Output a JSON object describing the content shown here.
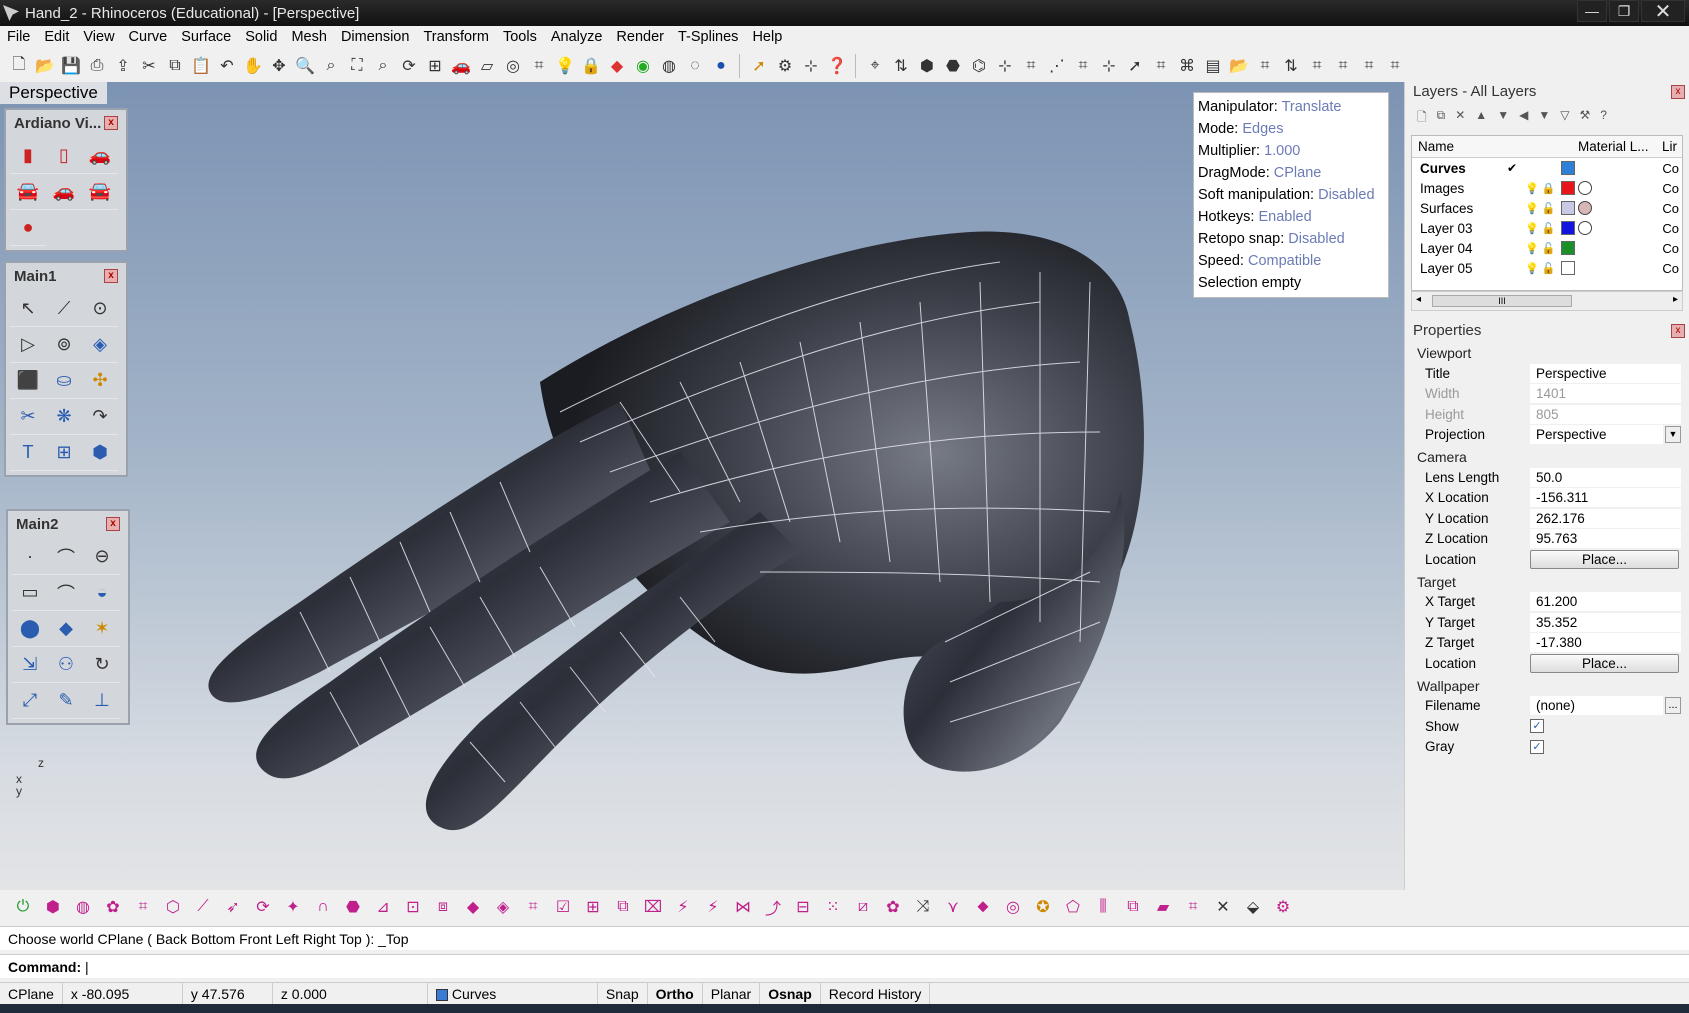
{
  "window": {
    "title": "Hand_2 - Rhinoceros (Educational) - [Perspective]",
    "minimize": "—",
    "maximize": "❐",
    "close": "✕"
  },
  "menu": [
    "File",
    "Edit",
    "View",
    "Curve",
    "Surface",
    "Solid",
    "Mesh",
    "Dimension",
    "Transform",
    "Tools",
    "Analyze",
    "Render",
    "T-Splines",
    "Help"
  ],
  "toolbar_icons": [
    "new-file-icon",
    "open-file-icon",
    "save-icon",
    "print-icon",
    "import-icon",
    "cut-icon",
    "copy-icon",
    "paste-icon",
    "undo-icon",
    "pan-hand-icon",
    "rotate-view-icon",
    "zoom-icon",
    "zoom-window-icon",
    "zoom-extents-icon",
    "zoom-selected-icon",
    "rotate-icon",
    "four-viewports-icon",
    "car-icon",
    "cplane-icon",
    "osnap-icon",
    "grid-icon",
    "light-icon",
    "lock-icon",
    "layer-icon",
    "color-wheel-icon",
    "wireframe-sphere-icon",
    "render-sphere-icon",
    "blue-sphere-icon",
    "pointer-icon",
    "gear-icon",
    "dimension-icon",
    "help-icon"
  ],
  "viewport": {
    "label": "Perspective",
    "axis_z": "z",
    "axis_x": "x",
    "axis_y": "y"
  },
  "panels": {
    "ardiano": {
      "title": "Ardiano Vi...",
      "close": "x"
    },
    "main1": {
      "title": "Main1",
      "close": "x"
    },
    "main2": {
      "title": "Main2",
      "close": "x"
    }
  },
  "tsplines_info": {
    "manipulator_label": "Manipulator:",
    "manipulator": "Translate",
    "mode_label": "Mode:",
    "mode": "Edges",
    "multiplier_label": "Multiplier:",
    "multiplier": "1.000",
    "dragmode_label": "DragMode:",
    "dragmode": "CPlane",
    "soft_label": "Soft manipulation:",
    "soft": "Disabled",
    "hotkeys_label": "Hotkeys:",
    "hotkeys": "Enabled",
    "retopo_label": "Retopo snap:",
    "retopo": "Disabled",
    "speed_label": "Speed:",
    "speed": "Compatible",
    "selection": "Selection empty"
  },
  "layers": {
    "title": "Layers - All Layers",
    "columns": {
      "name": "Name",
      "material": "Material L...",
      "linetype": "Lir"
    },
    "rows": [
      {
        "name": "Curves",
        "check": "✔",
        "color": "#2f7fd6",
        "line": "Co"
      },
      {
        "name": "Images",
        "check": "",
        "color": "#e8151b",
        "line": "Co"
      },
      {
        "name": "Surfaces",
        "check": "",
        "color": "#c9c9e6",
        "line": "Co"
      },
      {
        "name": "Layer 03",
        "check": "",
        "color": "#1414e0",
        "line": "Co"
      },
      {
        "name": "Layer 04",
        "check": "",
        "color": "#1d8f2a",
        "line": "Co"
      },
      {
        "name": "Layer 05",
        "check": "",
        "color": "#ffffff",
        "line": "Co"
      }
    ],
    "scroll_mark": "III"
  },
  "properties": {
    "title": "Properties",
    "section_viewport": "Viewport",
    "title_label": "Title",
    "title_value": "Perspective",
    "width_label": "Width",
    "width_value": "1401",
    "height_label": "Height",
    "height_value": "805",
    "projection_label": "Projection",
    "projection_value": "Perspective",
    "section_camera": "Camera",
    "lens_label": "Lens Length",
    "lens_value": "50.0",
    "xloc_label": "X Location",
    "xloc_value": "-156.311",
    "yloc_label": "Y Location",
    "yloc_value": "262.176",
    "zloc_label": "Z Location",
    "zloc_value": "95.763",
    "location_label": "Location",
    "place_button": "Place...",
    "section_target": "Target",
    "xtgt_label": "X Target",
    "xtgt_value": "61.200",
    "ytgt_label": "Y Target",
    "ytgt_value": "35.352",
    "ztgt_label": "Z Target",
    "ztgt_value": "-17.380",
    "tlocation_label": "Location",
    "tplace_button": "Place...",
    "section_wallpaper": "Wallpaper",
    "filename_label": "Filename",
    "filename_value": "(none)",
    "browse": "...",
    "show_label": "Show",
    "show_checked": "✓",
    "gray_label": "Gray",
    "gray_checked": "✓"
  },
  "command": {
    "history": "Choose world CPlane ( Back  Bottom  Front  Left  Right  Top ): _Top",
    "prompt": "Command:"
  },
  "status": {
    "cplane": "CPlane",
    "x": "x -80.095",
    "y": "y 47.576",
    "z": "z 0.000",
    "layer": "Curves",
    "snap": "Snap",
    "ortho": "Ortho",
    "planar": "Planar",
    "osnap": "Osnap",
    "record_history": "Record History"
  }
}
